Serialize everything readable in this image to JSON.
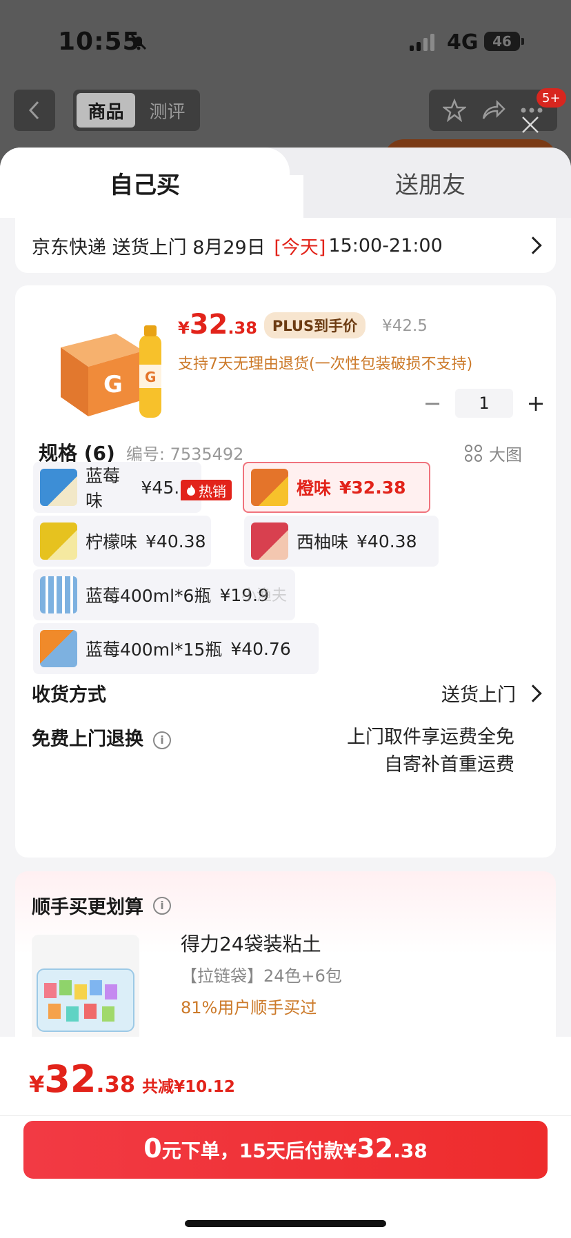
{
  "status_bar": {
    "time": "10:55",
    "network": "4G",
    "battery": "46"
  },
  "header": {
    "tab_product": "商品",
    "tab_review": "测评",
    "more_badge": "5+"
  },
  "sheet_tabs": {
    "self_buy": "自己买",
    "gift": "送朋友"
  },
  "delivery": {
    "carrier": "京东快递",
    "method": "送货上门",
    "date": "8月29日",
    "today": "[今天]",
    "window": "15:00-21:00"
  },
  "product": {
    "price_currency": "¥",
    "price_int": "32",
    "price_dec": ".38",
    "plus_tag": "PLUS到手价",
    "original_price": "¥42.5",
    "return_note": "支持7天无理由退货(一次性包装破损不支持)",
    "qty": "1",
    "minus": "−",
    "plus": "+"
  },
  "spec": {
    "title": "规格 (6)",
    "code_label": "编号:",
    "code": "7535492",
    "big_image": "大图",
    "hot_label": "热销"
  },
  "variants": [
    {
      "name": "蓝莓味",
      "price": "¥45.11",
      "color": "#3d8ed6",
      "selected": false
    },
    {
      "name": "橙味",
      "price": "¥32.38",
      "color": "#e4742a",
      "selected": true
    },
    {
      "name": "柠檬味",
      "price": "¥40.38",
      "color": "#e6c21f",
      "selected": false
    },
    {
      "name": "西柚味",
      "price": "¥40.38",
      "color": "#d8404f",
      "selected": false
    },
    {
      "name": "蓝莓400ml*6瓶",
      "price": "¥19.9",
      "color": "#7db1e0",
      "selected": false
    },
    {
      "name": "蓝莓400ml*15瓶",
      "price": "¥40.76",
      "color": "#f08a2a",
      "selected": false
    }
  ],
  "shipping": {
    "label": "收货方式",
    "value": "送货上门"
  },
  "returns": {
    "label": "免费上门退换",
    "line1": "上门取件享运费全免",
    "line2": "自寄补首重运费"
  },
  "addon": {
    "title": "顺手买更划算",
    "name": "得力24袋装粘土",
    "sub": "【拉链袋】24色+6包",
    "pct": "81%用户顺手买过"
  },
  "footer": {
    "currency": "¥",
    "total_int": "32",
    "total_dec": ".38",
    "saved": "共减¥10.12",
    "pay_zero": "0",
    "pay_text1": "元下单，15天后付款¥",
    "pay_int": "32",
    "pay_dec": ".38"
  },
  "watermark": "小渔夫",
  "colors": {
    "accent_red": "#e2231a",
    "plus_tag_bg": "#f7e5cf",
    "note_orange": "#cc7a2a"
  }
}
